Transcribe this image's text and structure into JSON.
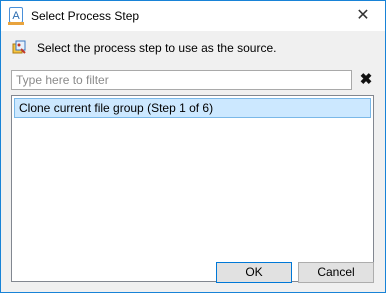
{
  "window": {
    "title": "Select Process Step",
    "app_icon_letter": "A",
    "close_glyph": "✕"
  },
  "dialog": {
    "instruction": "Select the process step to use as the source.",
    "filter": {
      "placeholder": "Type here to filter",
      "value": "",
      "clear_glyph": "✖"
    },
    "items": [
      {
        "label": "Clone current file group (Step 1 of 6)",
        "selected": true
      }
    ],
    "buttons": {
      "ok": "OK",
      "cancel": "Cancel"
    }
  },
  "icons": {
    "app": "app-logo-icon",
    "info": "process-step-icon",
    "close": "close-icon",
    "clear": "clear-filter-icon"
  },
  "colors": {
    "accent": "#0078d7",
    "selection": "#cce8ff",
    "selection_border": "#7ab8e8"
  }
}
